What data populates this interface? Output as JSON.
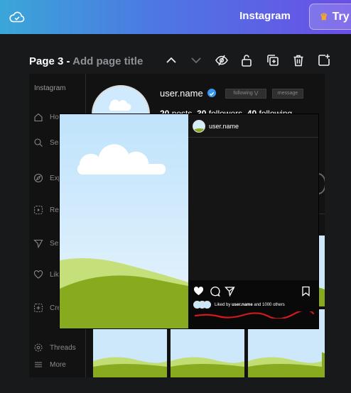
{
  "topbar": {
    "doc_title": "Instagram",
    "try_label": "Try",
    "colors": {
      "gradient_start": "#3aa6d8",
      "gradient_end": "#6a4fe6",
      "crown": "#f7a823"
    }
  },
  "page_header": {
    "page_number": "Page 3 - ",
    "title_placeholder": "Add page title",
    "tools": [
      "chevron-up-icon",
      "chevron-down-icon",
      "hide-icon",
      "lock-icon",
      "duplicate-page-icon",
      "trash-icon",
      "add-page-icon"
    ]
  },
  "ig": {
    "logo": "Instagram",
    "nav": [
      "Home",
      "Search",
      "Explore",
      "Reels",
      "Send",
      "Likes",
      "Create",
      "Threads",
      "More"
    ],
    "profile": {
      "username": "user.name",
      "follow_label": "following",
      "message_label": "message",
      "posts_count": "20",
      "posts_label": "posts",
      "followers_count": "30",
      "followers_label": "followers",
      "following_count": "40",
      "following_label": "following"
    }
  },
  "post": {
    "username": "user.name",
    "liked_by_prefix": "Liked by ",
    "liked_by_user": "user.name",
    "liked_by_suffix": " and 1000 others",
    "annotation_color": "#d4181b"
  }
}
